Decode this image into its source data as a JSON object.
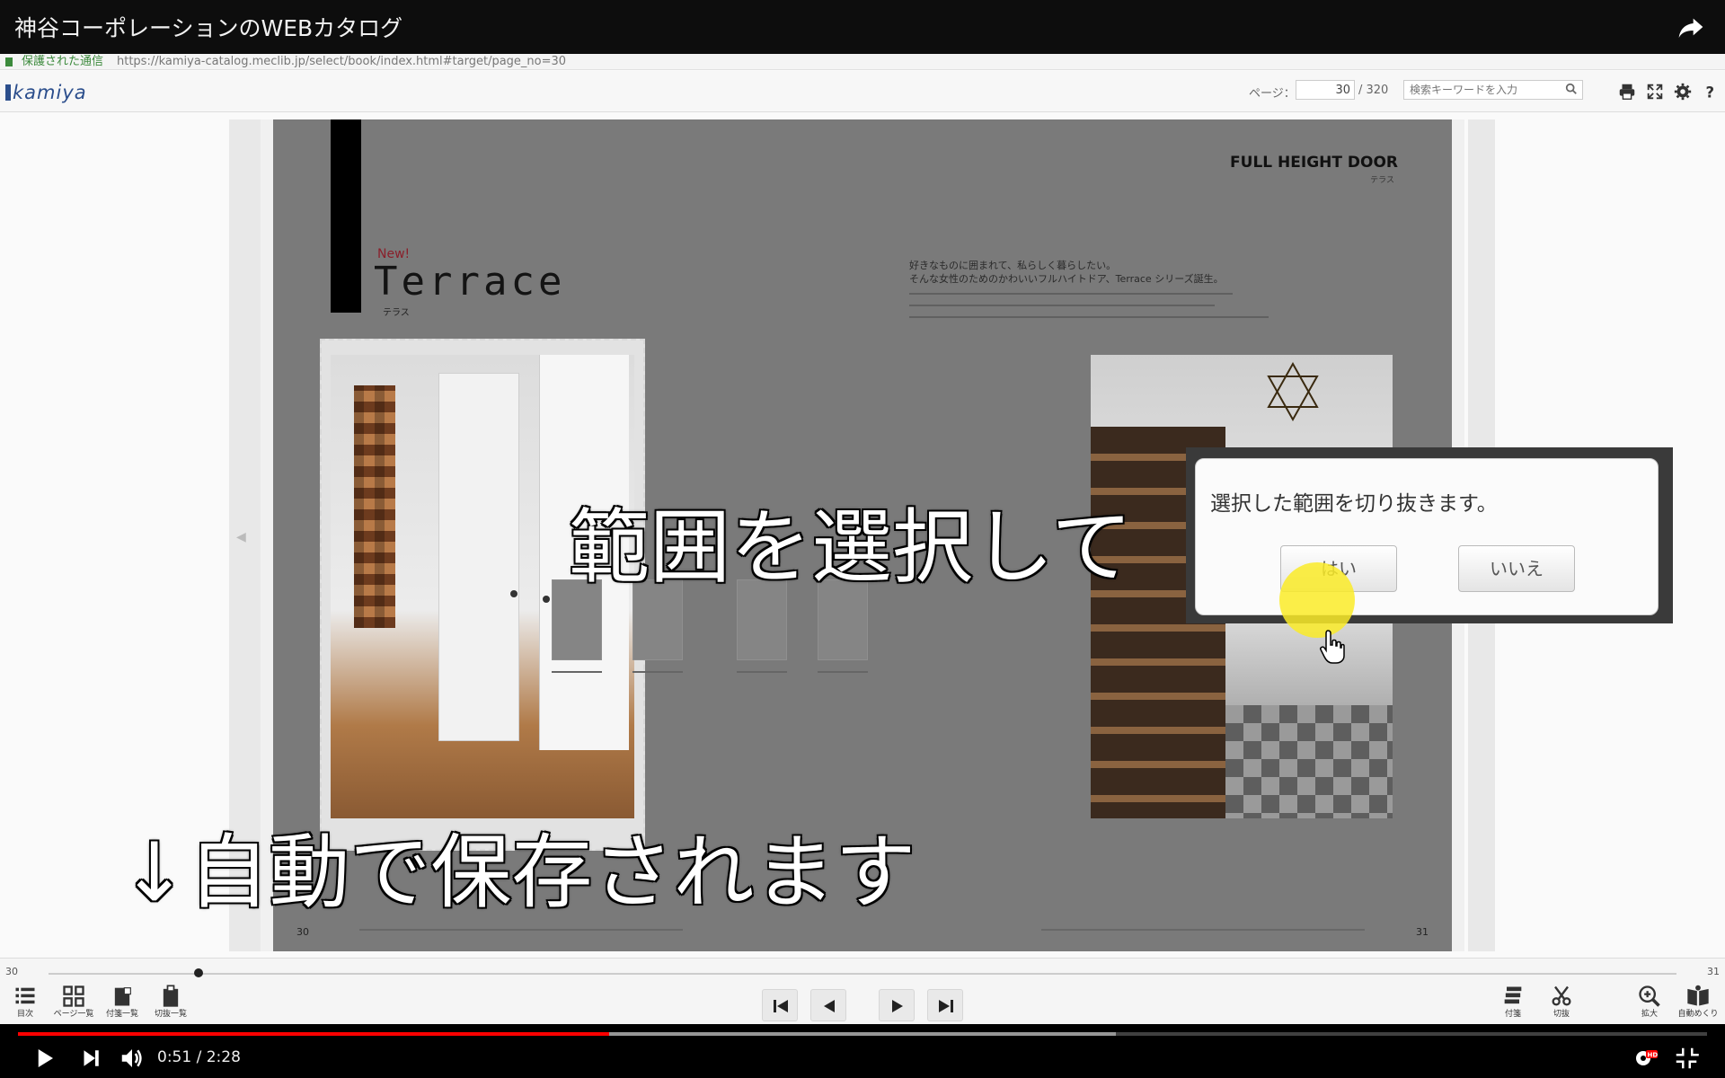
{
  "video": {
    "title": "神谷コーポレーションのWEBカタログ",
    "time_current": "0:51",
    "time_sep": " / ",
    "time_total": "2:28",
    "progress_fraction": 0.35,
    "buffered_fraction": 0.65
  },
  "browser": {
    "secure_label": "保護された通信",
    "url": "https://kamiya-catalog.meclib.jp/select/book/index.html#target/page_no=30"
  },
  "catalog_header": {
    "logo": "kamiya",
    "page_label": "ページ：",
    "page_value": "30",
    "page_total": "/ 320",
    "search_placeholder": "検索キーワードを入力"
  },
  "spread": {
    "new_label": "New!",
    "title": "Terrace",
    "title_kana": "テラス",
    "series_label": "FULL HEIGHT DOOR",
    "series_kana": "テラス",
    "intro_line1": "好きなものに囲まれて、私らしく暮らしたい。",
    "intro_line2": "そんな女性のためのかわいいフルハイトドア、Terrace シリーズ誕生。",
    "page_left": "30",
    "page_right": "31"
  },
  "captions": {
    "select_range": "範囲を選択して",
    "auto_save": "↓自動で保存されます"
  },
  "dialog": {
    "message": "選択した範囲を切り抜きます。",
    "yes": "はい",
    "no": "いいえ"
  },
  "catalog_footer": {
    "slider_left": "30",
    "slider_right": "31",
    "tools_left": [
      "目次",
      "ページ一覧",
      "付箋一覧",
      "切抜一覧"
    ],
    "tools_right": [
      "付箋",
      "切抜",
      "拡大",
      "自動めくり"
    ]
  },
  "colors": {
    "progress": "#ff0000",
    "logo": "#2b4e8c",
    "accent_new": "#8a1f2a"
  }
}
